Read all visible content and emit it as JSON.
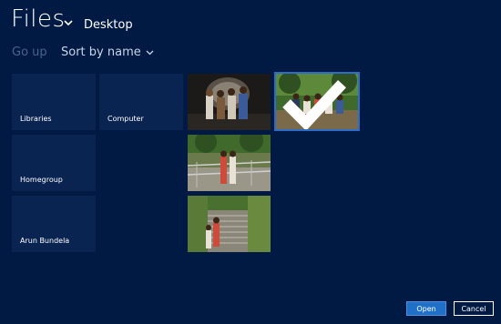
{
  "header": {
    "title": "Files",
    "location": "Desktop"
  },
  "toolbar": {
    "go_up": "Go up",
    "sort_label": "Sort by name"
  },
  "folders": [
    {
      "label": "Libraries"
    },
    {
      "label": "Computer"
    },
    {
      "label": "Homegroup"
    },
    {
      "label": "Arun Bundela"
    }
  ],
  "photos": [
    {
      "name": "photo-group-indoor",
      "selected": false
    },
    {
      "name": "photo-group-outdoor",
      "selected": true
    },
    {
      "name": "photo-stairs-railing",
      "selected": false
    },
    {
      "name": "photo-stone-stairs",
      "selected": false
    }
  ],
  "buttons": {
    "open": "Open",
    "cancel": "Cancel"
  },
  "colors": {
    "background": "#001a44",
    "tile": "#0a2452",
    "accent": "#2070c8"
  }
}
